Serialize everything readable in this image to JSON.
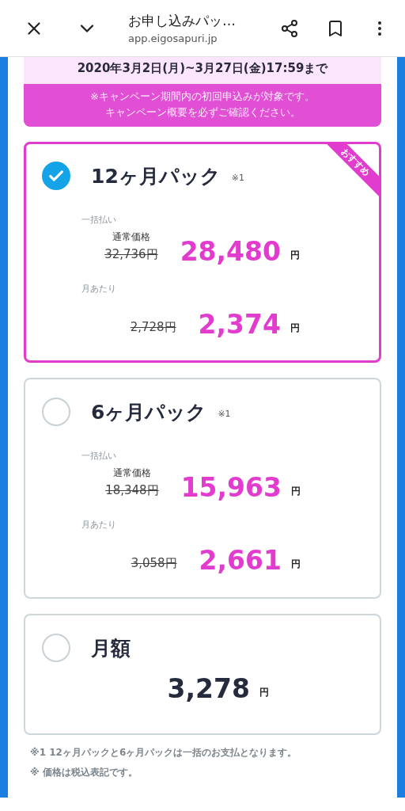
{
  "browser_bar": {
    "title": "お申し込みパッ…",
    "url": "app.eigosapuri.jp"
  },
  "campaign": {
    "period": "2020年3月2日(月)~3月27日(金)17:59まで",
    "notice": [
      "※キャンペーン期間内の初回申込みが対象です。",
      "キャンペーン概要を必ずご確認ください。"
    ]
  },
  "plans": [
    {
      "kind": "pack",
      "name": "12ヶ月パック",
      "note": "※1",
      "selected": true,
      "ribbon": "おすすめ",
      "lump_label": "一括払い",
      "regular_label": "通常価格",
      "regular_price": "32,736円",
      "price": "28,480",
      "unit": "円",
      "monthly_label": "月あたり",
      "monthly_regular": "2,728円",
      "monthly_price": "2,374",
      "monthly_unit": "円"
    },
    {
      "kind": "pack",
      "name": "6ヶ月パック",
      "note": "※1",
      "selected": false,
      "lump_label": "一括払い",
      "regular_label": "通常価格",
      "regular_price": "18,348円",
      "price": "15,963",
      "unit": "円",
      "monthly_label": "月あたり",
      "monthly_regular": "3,058円",
      "monthly_price": "2,661",
      "monthly_unit": "円"
    },
    {
      "kind": "monthly",
      "name": "月額",
      "selected": false,
      "price": "3,278",
      "unit": "円"
    }
  ],
  "footnotes": [
    "※1 12ヶ月パックと6ヶ月パックは一括のお支払となります。",
    "※ 価格は税込表記です。"
  ]
}
